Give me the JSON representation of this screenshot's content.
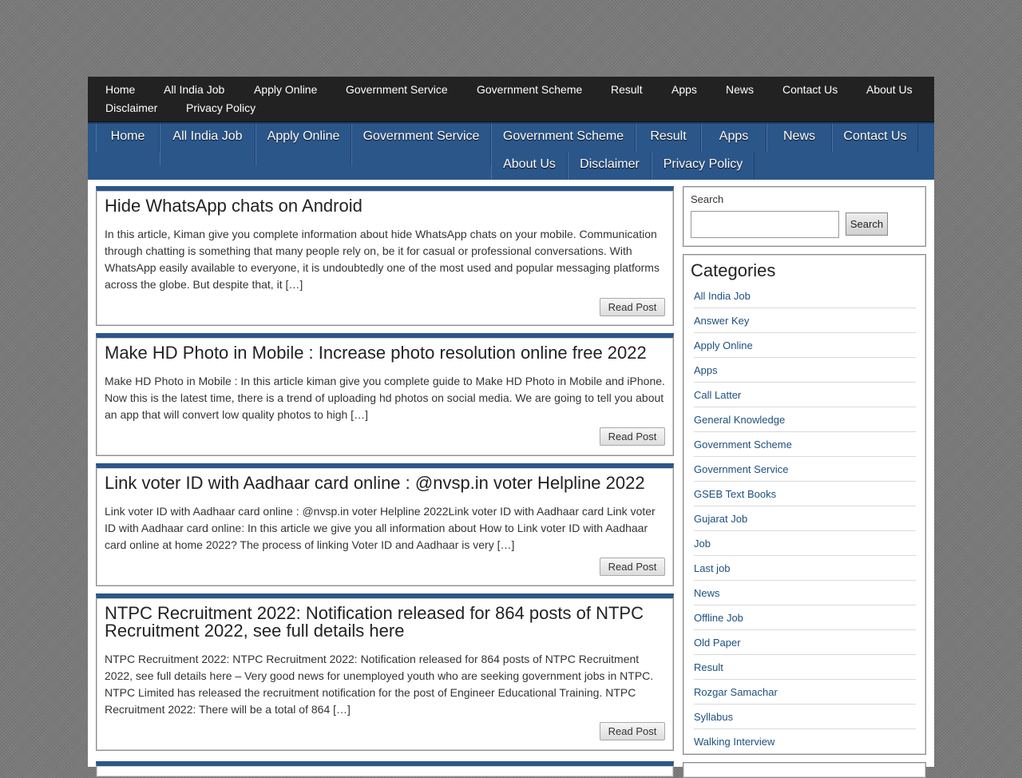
{
  "top_menu": [
    "Home",
    "All India Job",
    "Apply Online",
    "Government Service",
    "Government Scheme",
    "Result",
    "Apps",
    "News",
    "Contact Us",
    "About Us",
    "Disclaimer",
    "Privacy Policy"
  ],
  "nav": [
    "Home",
    "All India Job",
    "Apply Online",
    "Government Service",
    "Government Scheme",
    "Result",
    "Apps",
    "News",
    "Contact Us",
    "About Us",
    "Disclaimer",
    "Privacy Policy"
  ],
  "posts": [
    {
      "title": "Hide WhatsApp chats on Android",
      "excerpt": "In this article, Kiman give you complete information about hide WhatsApp chats on your mobile. Communication through chatting is something that many people rely on, be it for casual or professional conversations. With WhatsApp easily available to everyone, it is undoubtedly one of the most used and popular messaging platforms across the globe. But despite that, it […]",
      "button": "Read Post"
    },
    {
      "title": "Make HD Photo in Mobile : Increase photo resolution online free 2022",
      "excerpt": "Make HD Photo in Mobile : In this article kiman give you complete guide to Make HD Photo in Mobile and iPhone. Now this is the latest time, there is a trend of uploading hd photos on social media. We are going to tell you about an app that will convert low quality photos to high […]",
      "button": "Read Post"
    },
    {
      "title": "Link voter ID with Aadhaar card online : @nvsp.in voter Helpline 2022",
      "excerpt": "Link voter ID with Aadhaar card online : @nvsp.in voter Helpline 2022Link voter ID with Aadhaar card Link voter ID with Aadhaar card online: In this article we give you all information about How to Link voter ID with Aadhaar card online at home 2022? The process of linking Voter ID and Aadhaar is very […]",
      "button": "Read Post"
    },
    {
      "title": "NTPC Recruitment 2022: Notification released for 864 posts of NTPC Recruitment 2022, see full details here",
      "excerpt": "NTPC Recruitment 2022: NTPC Recruitment 2022: Notification released for 864 posts of NTPC Recruitment 2022, see full details here – Very good news for unemployed youth who are seeking government jobs in NTPC. NTPC Limited has released the recruitment notification for the post of Engineer Educational Training. NTPC Recruitment 2022: There will be a total of 864 […]",
      "button": "Read Post"
    }
  ],
  "search": {
    "label": "Search",
    "button": "Search",
    "value": ""
  },
  "categories": {
    "title": "Categories",
    "items": [
      "All India Job",
      "Answer Key",
      "Apply Online",
      "Apps",
      "Call Latter",
      "General Knowledge",
      "Government Scheme",
      "Government Service",
      "GSEB Text Books",
      "Gujarat Job",
      "Job",
      "Last job",
      "News",
      "Offline Job",
      "Old Paper",
      "Result",
      "Rozgar Samachar",
      "Syllabus",
      "Walking Interview"
    ]
  }
}
